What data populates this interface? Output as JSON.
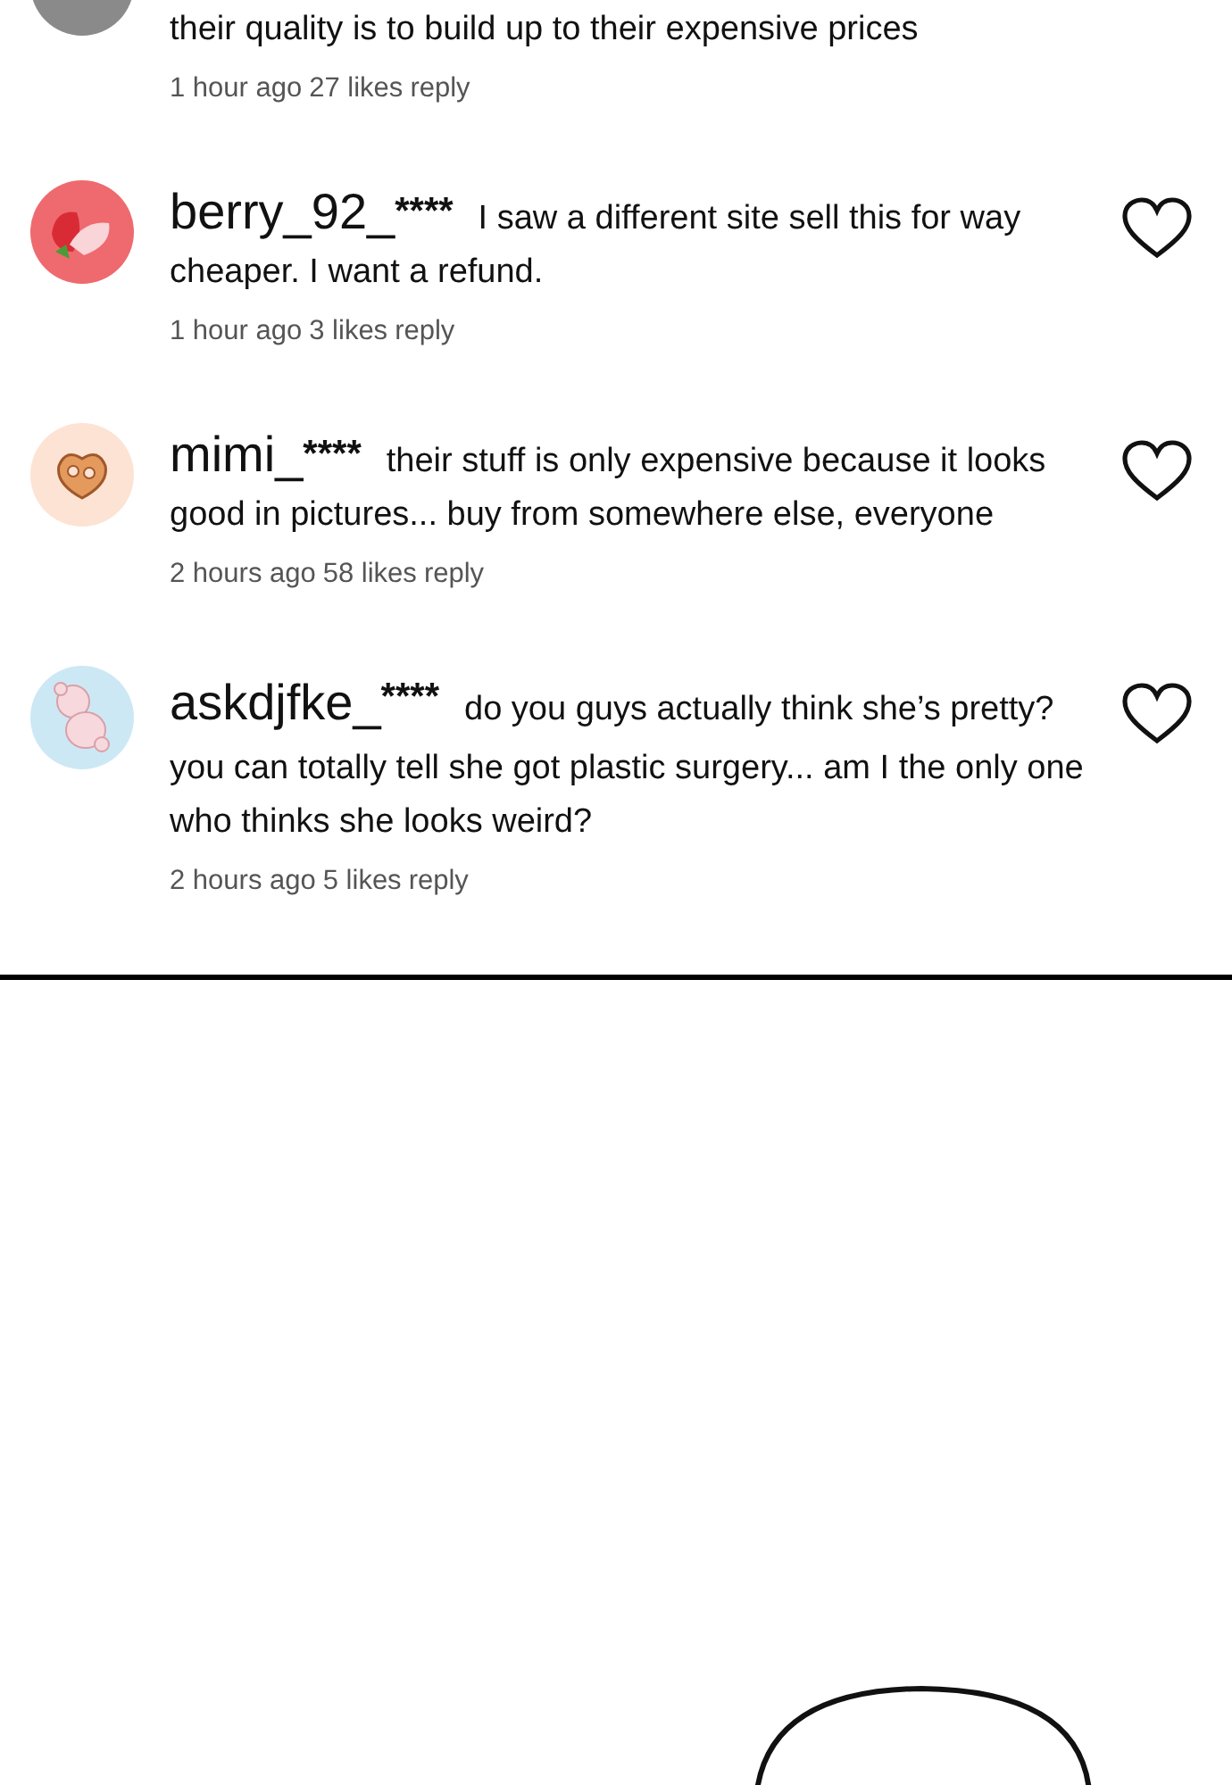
{
  "comments": [
    {
      "lines": [
        "their quality is to build up to their expensive prices"
      ],
      "time": "1 hour ago",
      "likes": "27 likes",
      "reply": "reply"
    },
    {
      "username": "berry_92_",
      "stars": "****",
      "lines": [
        "I saw a different site sell this for way",
        "cheaper. I want a refund."
      ],
      "time": "1 hour ago",
      "likes": "3 likes",
      "reply": "reply",
      "liked": false
    },
    {
      "username": "mimi_",
      "stars": "****",
      "lines": [
        "their stuff is only expensive because it looks",
        "good in pictures... buy from somewhere else, everyone"
      ],
      "time": "2 hours ago",
      "likes": "58 likes",
      "reply": "reply",
      "liked": false
    },
    {
      "username": "askdjfke_",
      "stars": "****",
      "lines": [
        "do you guys actually think she’s pretty?",
        "you can totally tell she got plastic surgery... am I the only one",
        "who thinks she looks weird?"
      ],
      "time": "2 hours ago",
      "likes": "5 likes",
      "reply": "reply",
      "liked": false
    }
  ]
}
